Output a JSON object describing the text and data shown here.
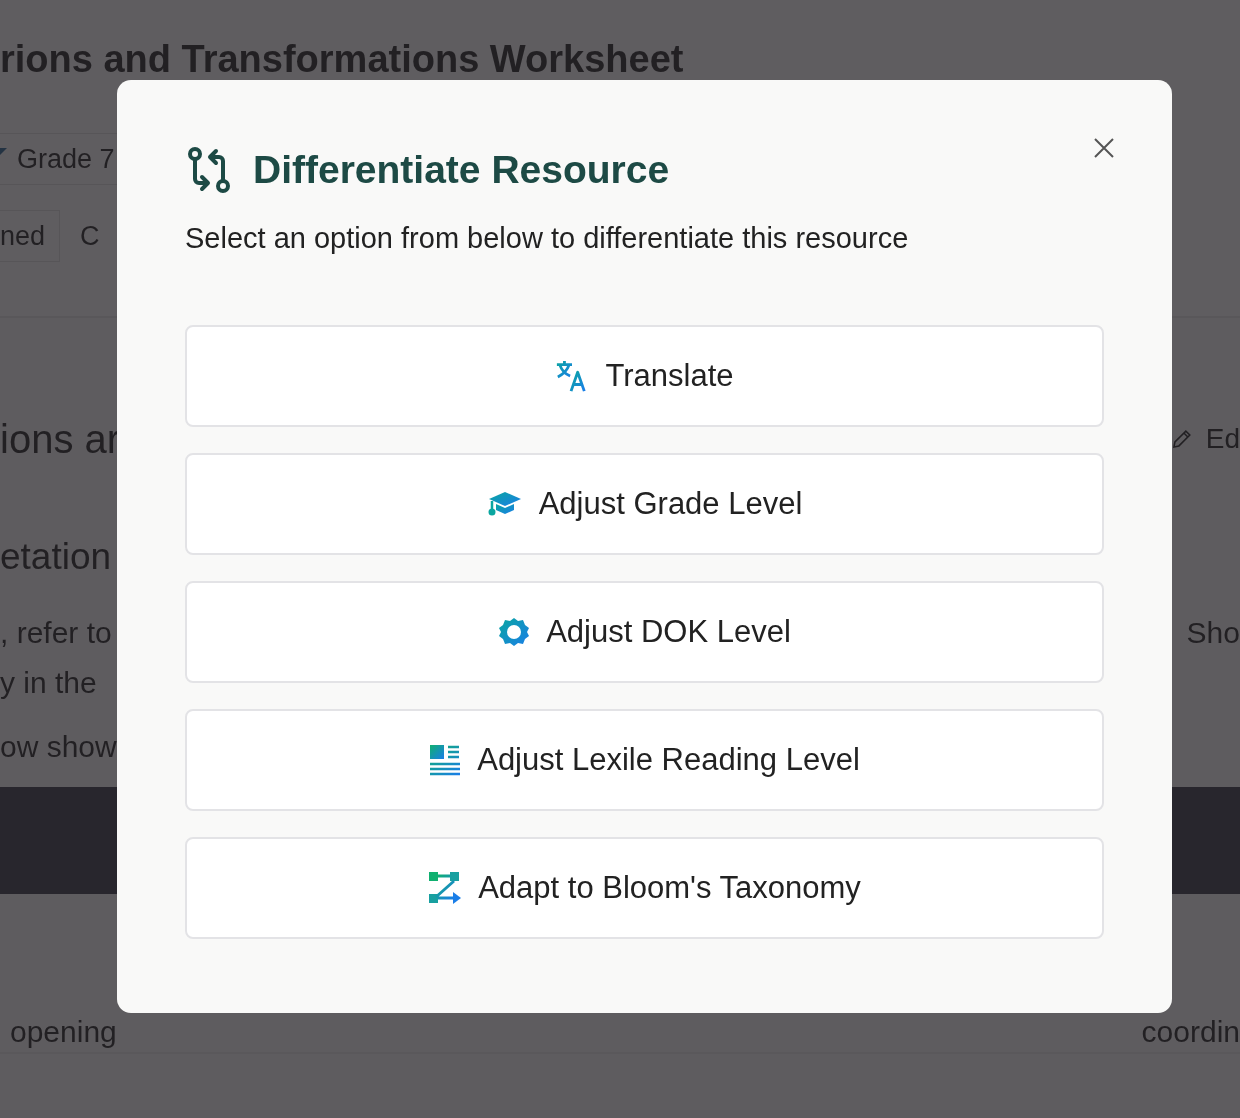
{
  "page": {
    "title": "rions and Transformations Worksheet",
    "grade_tag": "Grade 7",
    "status_tag": "ned",
    "tab": "C",
    "section_heading": "ions ar",
    "edit_button": "Ed",
    "subheading": "etation",
    "paragraph_lines": [
      ", refer to",
      "y in the",
      "ow show"
    ],
    "show_button": "Sho",
    "question_start": "opening",
    "question_end": "coordin"
  },
  "dialog": {
    "title": "Differentiate Resource",
    "subtitle": "Select an option from below to differentiate this resource",
    "options": [
      {
        "kind": "translate",
        "label": "Translate"
      },
      {
        "kind": "grade",
        "label": "Adjust Grade Level"
      },
      {
        "kind": "dok",
        "label": "Adjust DOK Level"
      },
      {
        "kind": "lexile",
        "label": "Adjust Lexile Reading Level"
      },
      {
        "kind": "bloom",
        "label": "Adapt to Bloom's Taxonomy"
      }
    ]
  }
}
